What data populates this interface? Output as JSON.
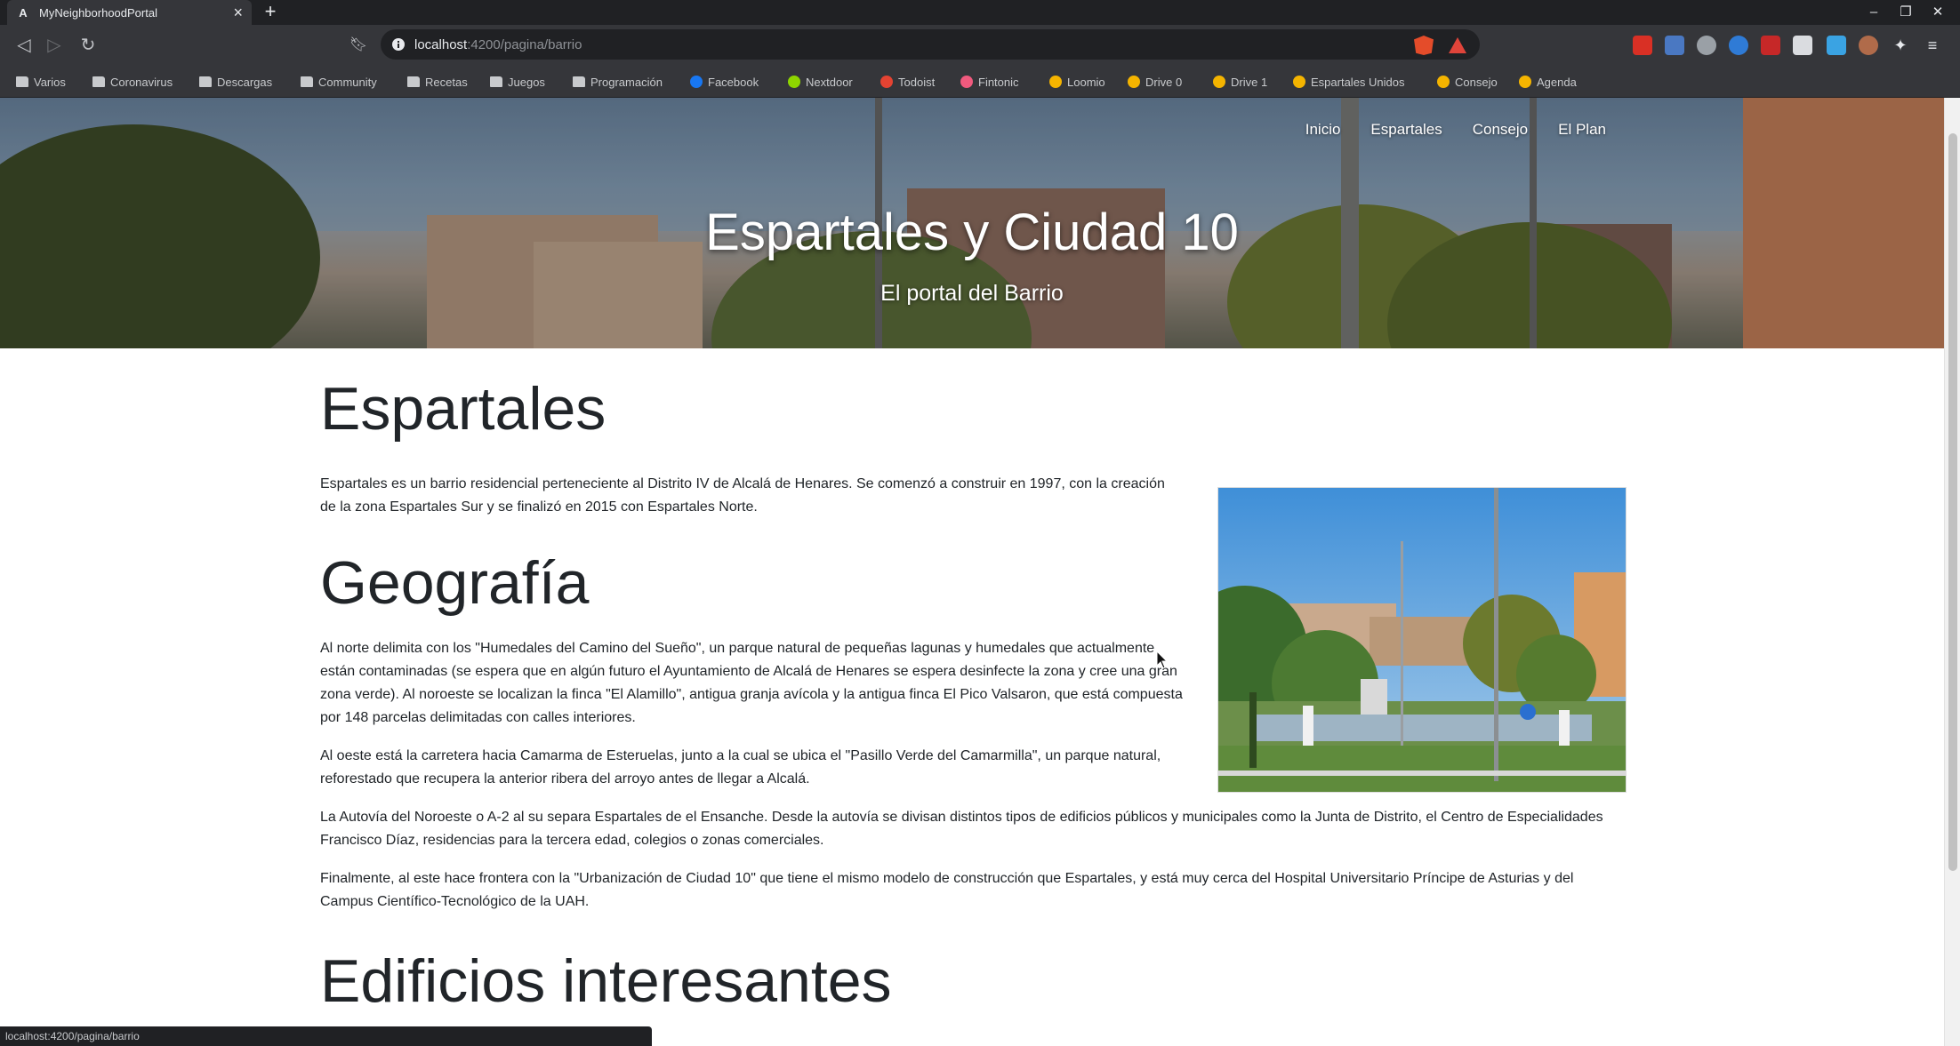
{
  "browser": {
    "tab_title": "MyNeighborhoodPortal",
    "tab_favicon": "A",
    "url_host": "localhost",
    "url_path": ":4200/pagina/barrio",
    "status_url": "localhost:4200/pagina/barrio",
    "bookmarks": [
      {
        "label": "Varios",
        "icon": "folder-icon"
      },
      {
        "label": "Coronavirus",
        "icon": "folder-icon"
      },
      {
        "label": "Descargas",
        "icon": "folder-icon"
      },
      {
        "label": "Community",
        "icon": "folder-icon"
      },
      {
        "label": "Recetas",
        "icon": "folder-icon"
      },
      {
        "label": "Juegos",
        "icon": "folder-icon"
      },
      {
        "label": "Programación",
        "icon": "folder-icon"
      },
      {
        "label": "Facebook",
        "icon": "facebook-icon",
        "color": "#1877f2"
      },
      {
        "label": "Nextdoor",
        "icon": "nextdoor-icon",
        "color": "#8ed500"
      },
      {
        "label": "Todoist",
        "icon": "todoist-icon",
        "color": "#e44332"
      },
      {
        "label": "Fintonic",
        "icon": "fintonic-icon",
        "color": "#f05a7e"
      },
      {
        "label": "Loomio",
        "icon": "loomio-icon",
        "color": "#f5b400"
      },
      {
        "label": "Drive 0",
        "icon": "drive-icon",
        "color": "#f4b400"
      },
      {
        "label": "Drive 1",
        "icon": "drive-icon",
        "color": "#f4b400"
      },
      {
        "label": "Espartales Unidos",
        "icon": "drive-icon",
        "color": "#f4b400"
      },
      {
        "label": "Consejo",
        "icon": "drive-icon",
        "color": "#f4b400"
      },
      {
        "label": "Agenda",
        "icon": "drive-icon",
        "color": "#f4b400"
      }
    ]
  },
  "site": {
    "nav": [
      "Inicio",
      "Espartales",
      "Consejo",
      "El Plan"
    ],
    "hero_title": "Espartales y Ciudad 10",
    "hero_subtitle": "El portal del Barrio"
  },
  "content": {
    "section1_title": "Espartales",
    "section1_text": "Espartales es un barrio residencial perteneciente al Distrito IV de Alcalá de Henares. Se comenzó a construir en 1997, con la creación de la zona Espartales Sur y se finalizó en 2015 con Espartales Norte.",
    "section2_title": "Geografía",
    "geo_p1": "Al norte delimita con los \"Humedales del Camino del Sueño\", un parque natural de pequeñas lagunas y humedales que actualmente están contaminadas (se espera que en algún futuro el Ayuntamiento de Alcalá de Henares se espera desinfecte la zona y cree una gran zona verde). Al noroeste se localizan la finca \"El Alamillo\", antigua granja avícola y la antigua finca El Pico Valsaron, que está compuesta por 148 parcelas delimitadas con calles interiores.",
    "geo_p2": "Al oeste está la carretera hacia Camarma de Esteruelas, junto a la cual se ubica el \"Pasillo Verde del Camarmilla\", un parque natural, reforestado que recupera la anterior ribera del arroyo antes de llegar a Alcalá.",
    "geo_p3": "La Autovía del Noroeste o A-2 al su separa Espartales de el Ensanche. Desde la autovía se divisan distintos tipos de edificios públicos y municipales como la Junta de Distrito, el Centro de Especialidades Francisco Díaz, residencias para la tercera edad, colegios o zonas comerciales.",
    "geo_p4": "Finalmente, al este hace frontera con la \"Urbanización de Ciudad 10\" que tiene el mismo modelo de construcción que Espartales, y está muy cerca del Hospital Universitario Príncipe de Asturias y del Campus Científico-Tecnológico de la UAH.",
    "section3_title": "Edificios interesantes"
  }
}
